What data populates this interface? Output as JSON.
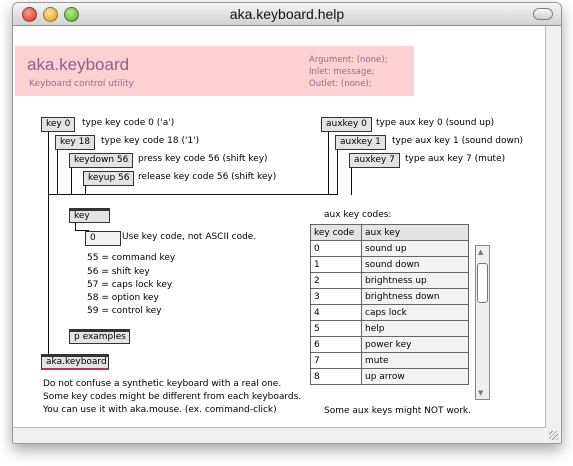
{
  "window": {
    "title": "aka.keyboard.help"
  },
  "header": {
    "title": "aka.keyboard",
    "subtitle": "Keyboard control utility",
    "argument": "Argument: (none);",
    "inlet": "Inlet: message;",
    "outlet": "Outlet: (none);"
  },
  "left": {
    "key0": "key 0",
    "key0_desc": "type key code 0 ('a')",
    "key18": "key 18",
    "key18_desc": "type key code 18 ('1')",
    "keydown": "keydown 56",
    "keydown_desc": "press key code 56 (shift key)",
    "keyup": "keyup 56",
    "keyup_desc": "release key code 56 (shift key)",
    "key_obj": "key",
    "num_box": "0",
    "num_desc": "Use key code, not ASCII code.",
    "codes": [
      "55 = command key",
      "56 = shift key",
      "57 = caps lock key",
      "58 = option key",
      "59 = control key"
    ],
    "p_examples": "p examples",
    "aka_obj": "aka.keyboard",
    "note1": "Do not confuse a synthetic keyboard with a real one.",
    "note2": "Some key codes might be different from each keyboards.",
    "note3": "You can use it with aka.mouse. (ex. command-click)"
  },
  "right": {
    "aux0": "auxkey 0",
    "aux0_desc": "type aux key 0 (sound up)",
    "aux1": "auxkey 1",
    "aux1_desc": "type aux key 1 (sound down)",
    "aux7": "auxkey 7",
    "aux7_desc": "type aux key 7 (mute)",
    "table_title": "aux key codes:",
    "col1": "key code",
    "col2": "aux key",
    "rows": [
      {
        "code": "0",
        "name": "sound up"
      },
      {
        "code": "1",
        "name": "sound down"
      },
      {
        "code": "2",
        "name": "brightness up"
      },
      {
        "code": "3",
        "name": "brightness down"
      },
      {
        "code": "4",
        "name": "caps lock"
      },
      {
        "code": "5",
        "name": "help"
      },
      {
        "code": "6",
        "name": "power key"
      },
      {
        "code": "7",
        "name": "mute"
      },
      {
        "code": "8",
        "name": "up arrow"
      }
    ],
    "note": "Some aux keys might NOT work."
  }
}
